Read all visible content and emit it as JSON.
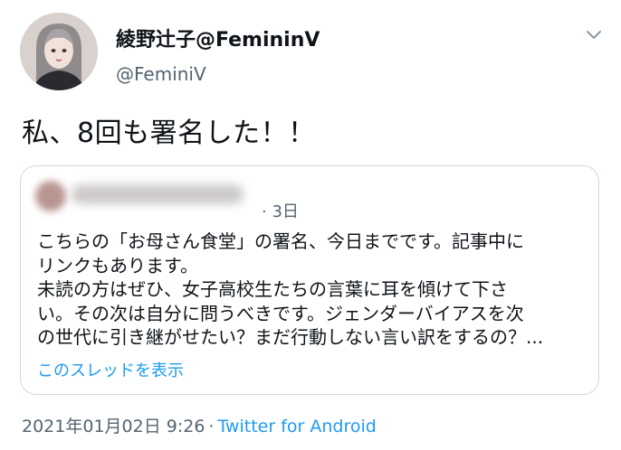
{
  "author": {
    "display_name": "綾野辻子@FemininV",
    "handle": "@FeminiV"
  },
  "tweet": {
    "text": "私、8回も署名した！！"
  },
  "quote": {
    "time": "3日",
    "lines": [
      "こちらの「お母さん食堂」の署名、今日までです。記事中に",
      "リンクもあります。",
      "未読の方はぜひ、女子高校生たちの言葉に耳を傾けて下さ",
      "い。その次は自分に問うべきです。ジェンダーバイアスを次",
      "の世代に引き継がせたい？まだ行動しない言い訳をするの？..."
    ],
    "thread_link": "このスレッドを表示"
  },
  "footer": {
    "datetime": "2021年01月02日 9:26",
    "separator": "·",
    "source": "Twitter for Android"
  },
  "colors": {
    "link": "#1d9bf0",
    "secondary": "#536471",
    "border": "#cfd9de"
  },
  "icons": {
    "menu": "chevron-down-icon"
  }
}
